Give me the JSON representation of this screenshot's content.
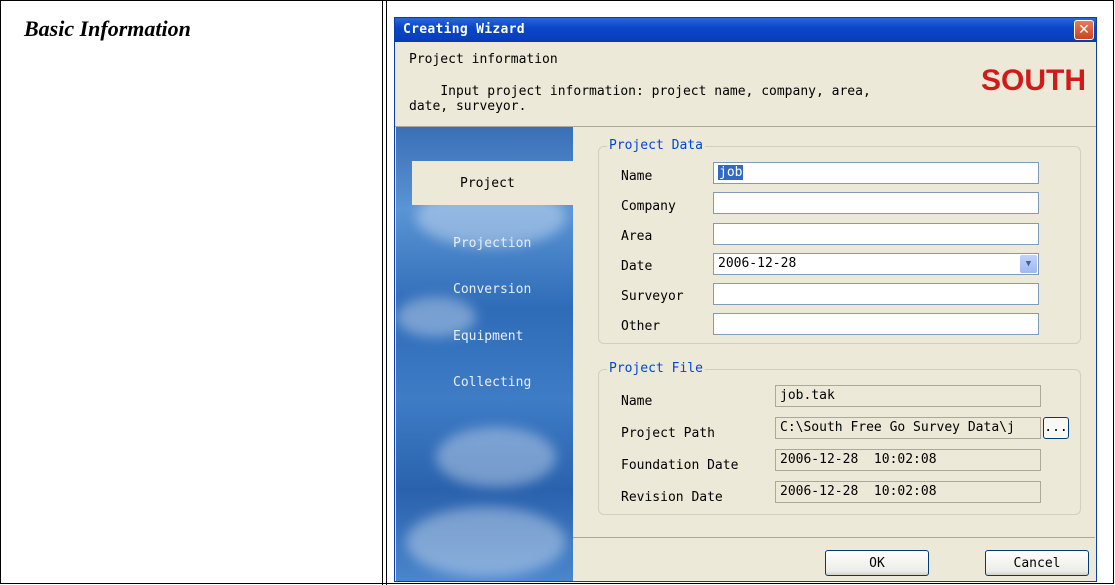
{
  "document": {
    "heading": "Basic Information"
  },
  "dialog": {
    "title": "Creating Wizard",
    "close_label": "✕",
    "header": {
      "title": "Project information",
      "description": "    Input project information: project name, company, area,\ndate, surveyor.",
      "logo_text": "SOUTH"
    },
    "sidebar": {
      "items": [
        {
          "label": "Project",
          "active": true
        },
        {
          "label": "Projection",
          "active": false
        },
        {
          "label": "Conversion",
          "active": false
        },
        {
          "label": "Equipment",
          "active": false
        },
        {
          "label": "Collecting",
          "active": false
        }
      ]
    },
    "project_data": {
      "legend": "Project Data",
      "name_label": "Name",
      "name_value": "job",
      "company_label": "Company",
      "company_value": "",
      "area_label": "Area",
      "area_value": "",
      "date_label": "Date",
      "date_value": "2006-12-28",
      "surveyor_label": "Surveyor",
      "surveyor_value": "",
      "other_label": "Other",
      "other_value": ""
    },
    "project_file": {
      "legend": "Project File",
      "name_label": "Name",
      "name_value": "job.tak",
      "path_label": "Project Path",
      "path_value": "C:\\South Free Go Survey Data\\j",
      "browse_label": "...",
      "foundation_label": "Foundation Date",
      "foundation_value": "2006-12-28  10:02:08",
      "revision_label": "Revision Date",
      "revision_value": "2006-12-28  10:02:08"
    },
    "buttons": {
      "ok": "OK",
      "cancel": "Cancel"
    },
    "colors": {
      "titlebar": "#0a46c9",
      "group_label": "#0046d5",
      "logo": "#d11a1a",
      "dialog_bg": "#ece9d8"
    }
  }
}
